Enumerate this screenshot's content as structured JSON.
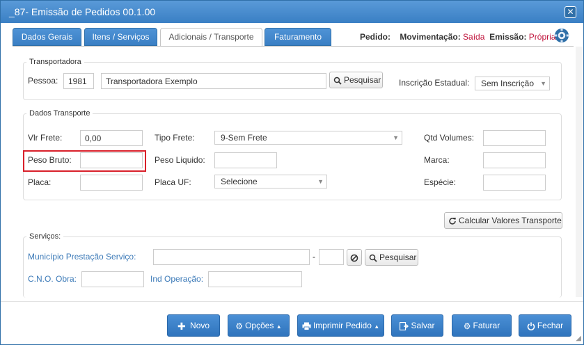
{
  "window": {
    "title": "_87- Emissão de Pedidos 00.1.00"
  },
  "tabs": [
    {
      "label": "Dados Gerais"
    },
    {
      "label": "Itens / Serviços"
    },
    {
      "label": "Adicionais / Transporte"
    },
    {
      "label": "Faturamento"
    }
  ],
  "status": {
    "pedido_label": "Pedido:",
    "movimentacao_label": "Movimentação:",
    "movimentacao_value": "Saída",
    "emissao_label": "Emissão:",
    "emissao_value": "Própria"
  },
  "transportadora": {
    "legend": "Transportadora",
    "pessoa_label": "Pessoa:",
    "pessoa_code": "1981",
    "pessoa_name": "Transportadora Exemplo",
    "search_label": "Pesquisar",
    "ie_label": "Inscrição Estadual:",
    "ie_value": "Sem Inscrição"
  },
  "transporte": {
    "legend": "Dados Transporte",
    "vlr_frete_label": "Vlr Frete:",
    "vlr_frete_value": "0,00",
    "tipo_frete_label": "Tipo Frete:",
    "tipo_frete_value": "9-Sem Frete",
    "qtd_volumes_label": "Qtd Volumes:",
    "qtd_volumes_value": "",
    "peso_bruto_label": "Peso Bruto:",
    "peso_bruto_value": "",
    "peso_liquido_label": "Peso Liquido:",
    "peso_liquido_value": "",
    "marca_label": "Marca:",
    "marca_value": "",
    "placa_label": "Placa:",
    "placa_value": "",
    "placa_uf_label": "Placa UF:",
    "placa_uf_value": "Selecione",
    "especie_label": "Espécie:",
    "especie_value": ""
  },
  "calc_button": "Calcular Valores Transporte",
  "servicos": {
    "legend": "Serviços:",
    "municipio_label": "Município Prestação Serviço:",
    "municipio_value": "",
    "dash": "-",
    "search_label": "Pesquisar",
    "cno_label": "C.N.O. Obra:",
    "cno_value": "",
    "ind_operacao_label": "Ind Operação:",
    "ind_operacao_value": ""
  },
  "footer": {
    "novo": "Novo",
    "opcoes": "Opções",
    "imprimir": "Imprimir Pedido",
    "salvar": "Salvar",
    "faturar": "Faturar",
    "fechar": "Fechar"
  },
  "colors": {
    "primary": "#3a7fc4",
    "accent_red": "#c0143c",
    "highlight": "#d9202a"
  }
}
